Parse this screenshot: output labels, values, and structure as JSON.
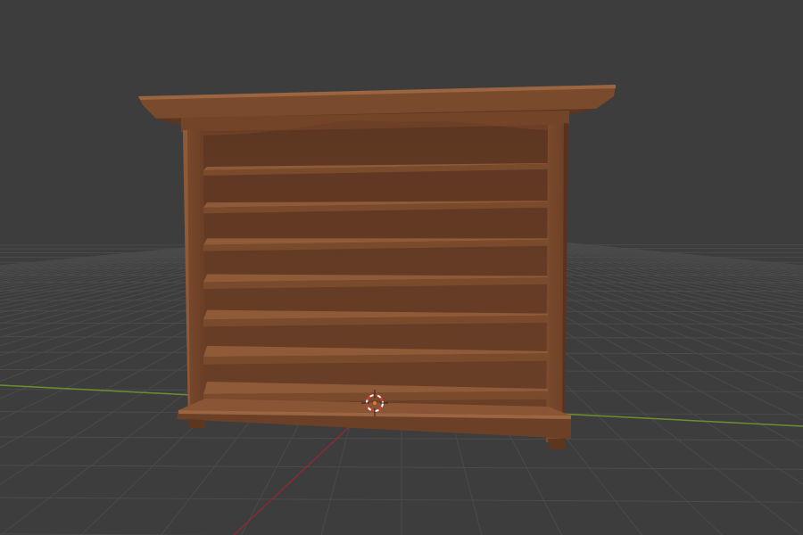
{
  "viewport": {
    "background": "#3d3d3d",
    "grid_line_color": "#4a4a4a",
    "x_axis_color": "#7a1f2a",
    "y_axis_color": "#6b8f2f",
    "origin_marker_icon": "3d-cursor-icon"
  },
  "object": {
    "kind": "bookshelf",
    "wood_color": "#7a4a2c",
    "wood_highlight": "#8f5a38",
    "wood_shadow": "#5a3320",
    "shelf_count": 7
  }
}
